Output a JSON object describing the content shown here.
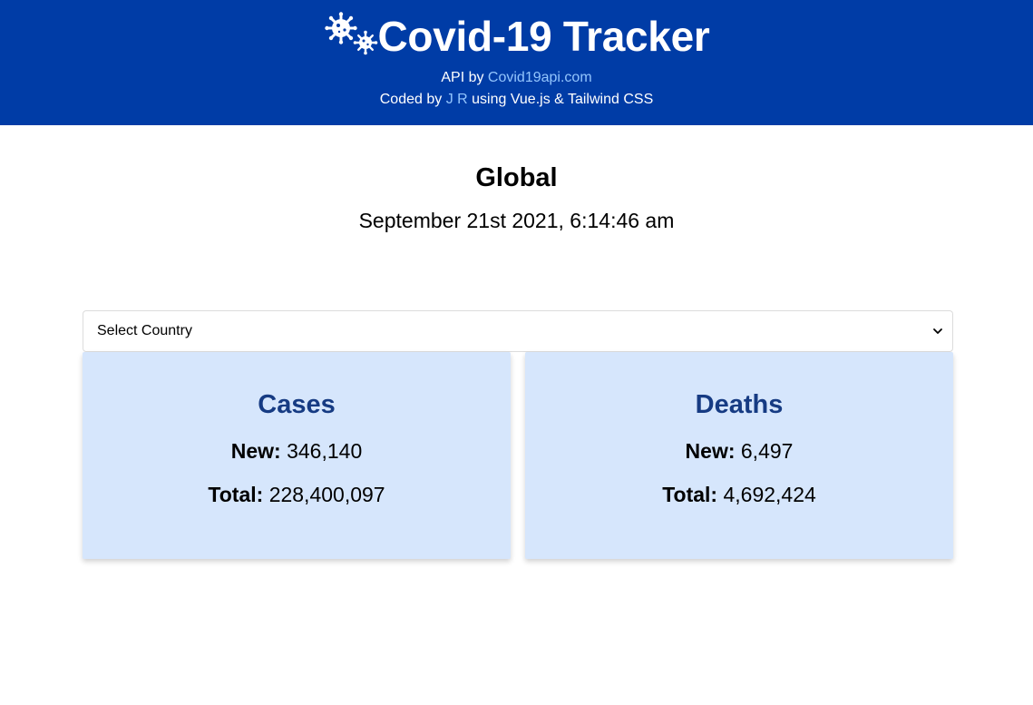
{
  "header": {
    "title": "Covid-19 Tracker",
    "logo_icon": "virus-icon",
    "api_prefix": "API by ",
    "api_link": "Covid19api.com",
    "coded_prefix": "Coded by ",
    "author_link": "J R",
    "coded_suffix": " using Vue.js & Tailwind CSS",
    "bg_color": "#003ca6",
    "link_color": "#93c5fd"
  },
  "main": {
    "region": "Global",
    "datetime": "September 21st 2021, 6:14:46 am"
  },
  "country_select": {
    "selected": "Select Country"
  },
  "cards": {
    "cases": {
      "title": "Cases",
      "new_label": "New:",
      "new_value": "346,140",
      "total_label": "Total:",
      "total_value": "228,400,097"
    },
    "deaths": {
      "title": "Deaths",
      "new_label": "New:",
      "new_value": "6,497",
      "total_label": "Total:",
      "total_value": "4,692,424"
    },
    "card_bg": "#d6e6fc",
    "title_color": "#163b83"
  }
}
